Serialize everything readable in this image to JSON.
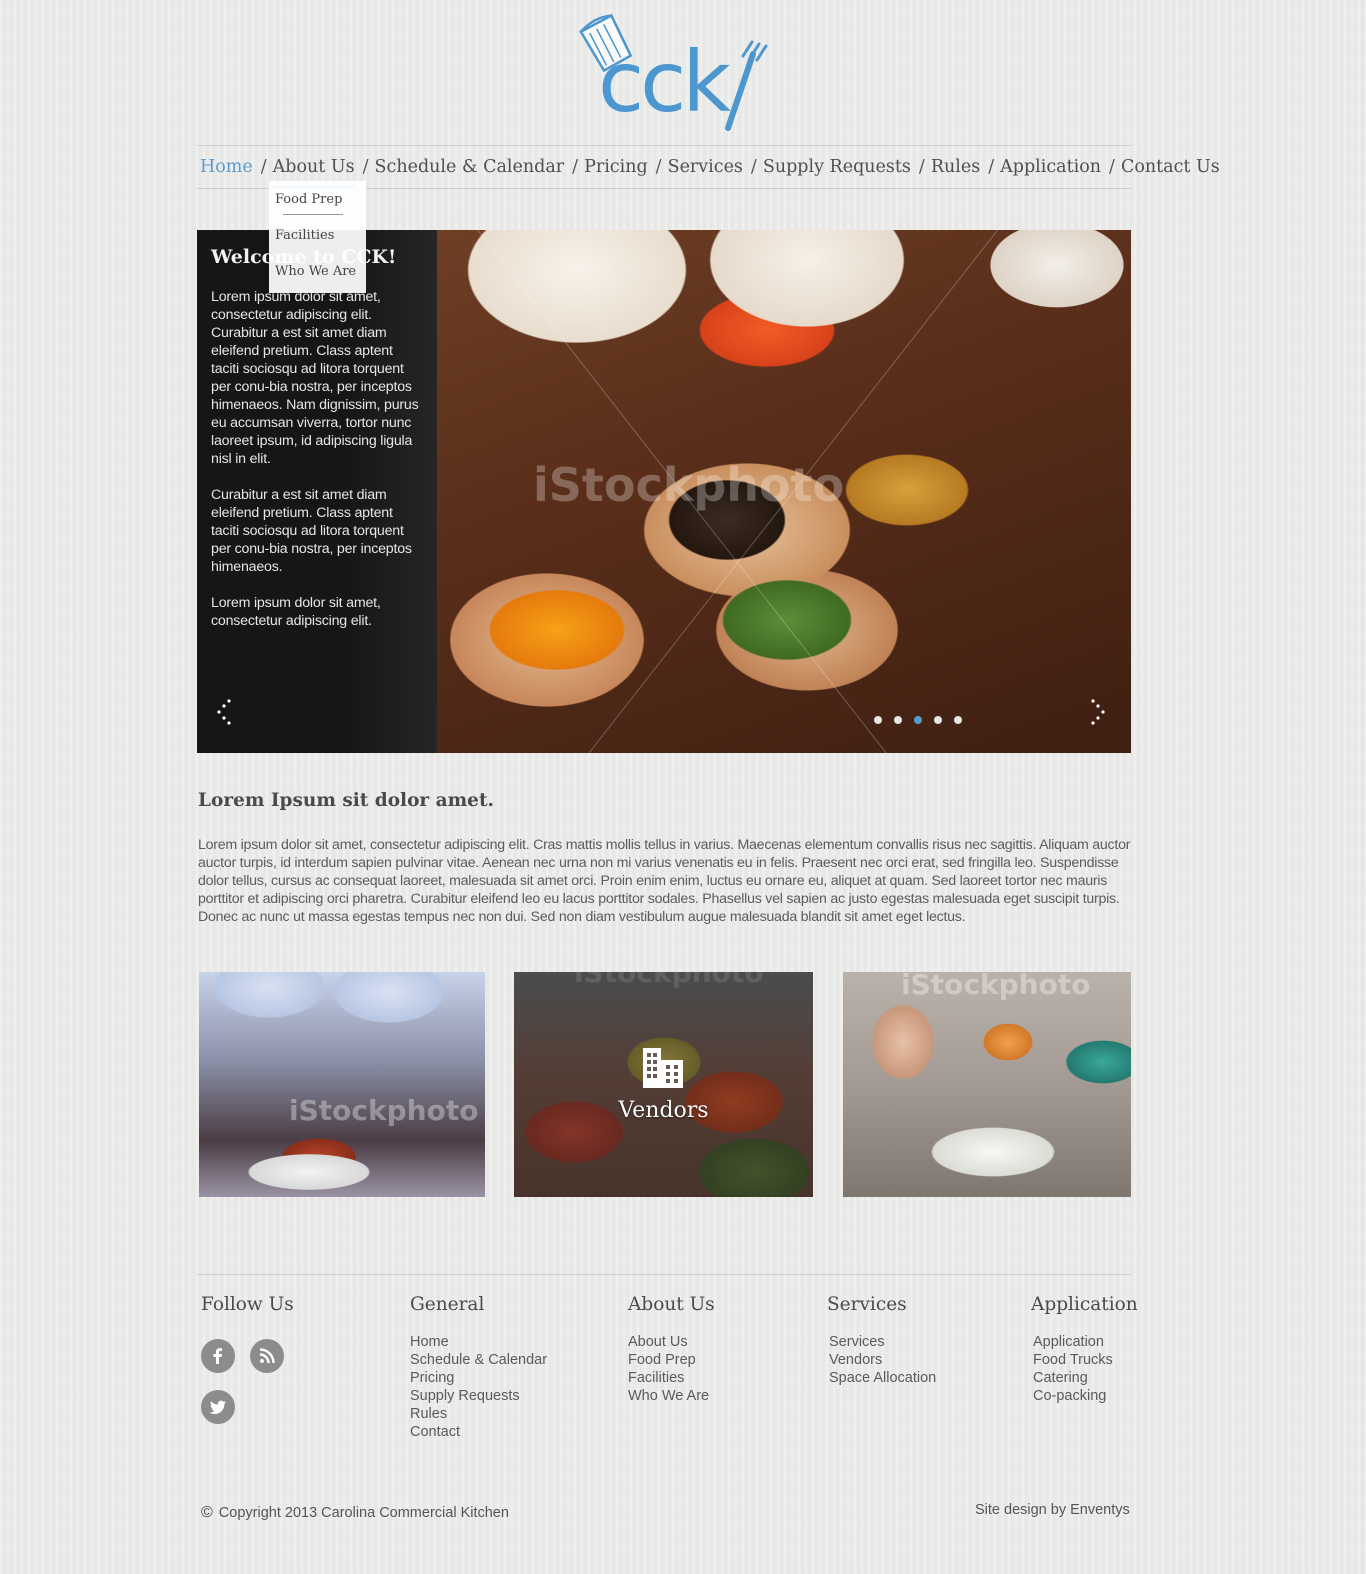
{
  "brand": {
    "logo_text": "cck",
    "accent_color": "#5a9ccd"
  },
  "nav": {
    "items": [
      {
        "label": "Home"
      },
      {
        "label": "About Us"
      },
      {
        "label": "Schedule & Calendar"
      },
      {
        "label": "Pricing"
      },
      {
        "label": "Services"
      },
      {
        "label": "Supply Requests"
      },
      {
        "label": "Rules"
      },
      {
        "label": "Application"
      },
      {
        "label": "Contact Us"
      }
    ],
    "separator": "/",
    "active": "Home",
    "open_menu": "About Us",
    "dropdown": [
      "Food Prep",
      "Facilities",
      "Who We Are"
    ]
  },
  "slider": {
    "title": "Welcome to CCK!",
    "paragraphs": [
      "Lorem ipsum dolor sit amet, consectetur adipiscing elit. Curabitur a est sit amet diam eleifend pretium. Class aptent taciti sociosqu ad litora torquent per conu-bia nostra, per inceptos himenaeos. Nam dignissim, purus eu accumsan viverra, tortor nunc laoreet ipsum, id adipiscing ligula nisl in elit.",
      "Curabitur a est sit amet diam eleifend pretium. Class aptent taciti sociosqu ad litora torquent per conu-bia nostra, per inceptos himenaeos.",
      "Lorem ipsum dolor sit amet, consectetur adipiscing elit."
    ],
    "watermark": "iStockphoto",
    "slide_count": 5,
    "active_slide": 3
  },
  "intro": {
    "title": "Lorem Ipsum sit dolor amet.",
    "body": "Lorem ipsum dolor sit amet, consectetur adipiscing elit. Cras mattis mollis tellus in varius. Maecenas elementum convallis risus nec sagittis. Aliquam auctor auctor turpis, id interdum sapien pulvinar vitae. Aenean nec urna non mi varius venenatis eu in felis. Praesent nec orci erat, sed fringilla leo. Suspendisse dolor tellus, cursus ac consequat laoreet, malesuada sit amet orci. Proin enim enim, luctus eu ornare eu, aliquet at quam. Sed laoreet tortor nec mauris porttitor et adipiscing orci pharetra. Curabitur eleifend leo eu lacus porttitor sodales. Phasellus vel sapien ac justo egestas malesuada eget suscipit turpis. Donec ac nunc ut massa egestas tempus nec non dui. Sed non diam vestibulum augue malesuada blandit sit amet eget lectus."
  },
  "tiles": {
    "watermark": "iStockphoto",
    "vendors_label": "Vendors"
  },
  "footer": {
    "follow": {
      "title": "Follow Us",
      "icons": [
        "facebook-icon",
        "rss-icon",
        "twitter-icon"
      ]
    },
    "general": {
      "title": "General",
      "links": [
        "Home",
        "Schedule & Calendar",
        "Pricing",
        "Supply Requests",
        "Rules",
        "Contact"
      ]
    },
    "about": {
      "title": "About Us",
      "links": [
        "About Us",
        "Food Prep",
        "Facilities",
        "Who We Are"
      ]
    },
    "services": {
      "title": "Services",
      "links": [
        "Services",
        "Vendors",
        "Space Allocation"
      ]
    },
    "application": {
      "title": "Application",
      "links": [
        "Application",
        "Food Trucks",
        "Catering",
        "Co-packing"
      ]
    },
    "copyright": "Copyright 2013 Carolina Commercial Kitchen",
    "copyright_symbol": "©",
    "credit": "Site design by Enventys"
  }
}
